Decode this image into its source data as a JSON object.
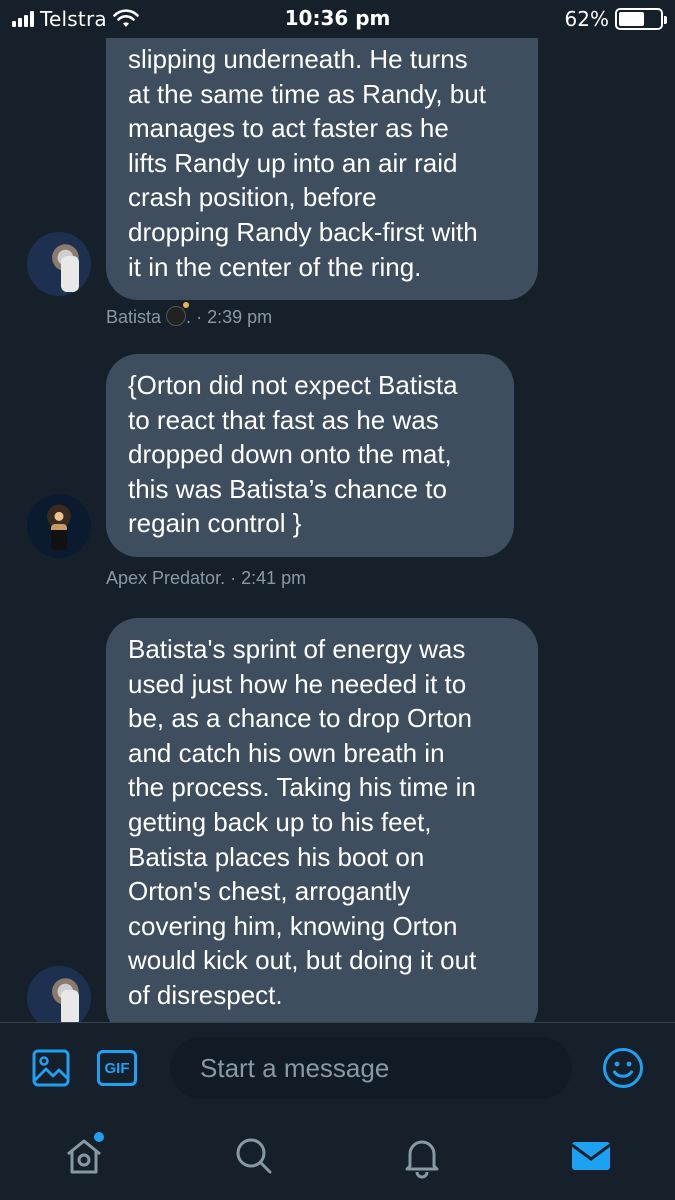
{
  "status_bar": {
    "carrier": "Telstra",
    "time": "10:36 pm",
    "battery": "62%",
    "battery_level": 0.62
  },
  "messages": [
    {
      "text": "slipping underneath. He turns\nat the same time as Randy, but\nmanages to act faster as he\nlifts Randy up into an air raid\ncrash position, before\ndropping Randy back-first with\nit in the center of the ring.",
      "sender": "Batista",
      "sender_suffix": ".",
      "timestamp": "· 2:39 pm"
    },
    {
      "text": "{Orton did not expect Batista\nto react that fast as he was\ndropped down onto the mat,\nthis was Batista’s chance to\nregain control }",
      "sender": "Apex Predator.",
      "timestamp": "· 2:41 pm"
    },
    {
      "text": "Batista's sprint of energy was\nused just how he needed it to\nbe, as a chance to drop Orton\nand catch his own breath in\nthe process. Taking his time in\ngetting back up to his feet,\nBatista places his boot on\nOrton's chest, arrogantly\ncovering him, knowing Orton\nwould kick out, but doing it out\nof disrespect."
    }
  ],
  "composer": {
    "gif_label": "GIF",
    "placeholder": "Start a message"
  },
  "icons": {
    "image": "image-icon",
    "gif": "gif-icon",
    "emoji": "emoji-icon",
    "home": "home-icon",
    "search": "search-icon",
    "notifications": "bell-icon",
    "messages": "envelope-icon"
  },
  "colors": {
    "background": "#15202b",
    "bubble": "#3e4e5e",
    "accent": "#1da1f2",
    "meta": "#8899a6"
  }
}
